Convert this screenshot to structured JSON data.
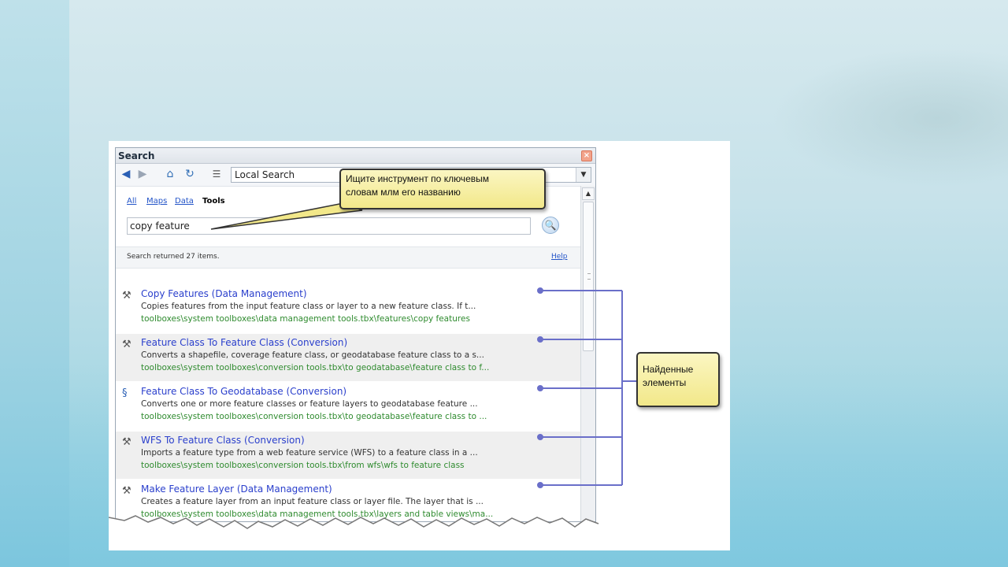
{
  "window": {
    "title": "Search",
    "close_glyph": "×"
  },
  "toolbar": {
    "back_icon": "back-arrow-icon",
    "forward_icon": "forward-arrow-icon",
    "home_icon": "home-icon",
    "refresh_icon": "refresh-icon",
    "index_icon": "index-icon",
    "scope_value": "Local Search"
  },
  "tabs": [
    {
      "label": "All"
    },
    {
      "label": "Maps"
    },
    {
      "label": "Data"
    },
    {
      "label": "Tools"
    }
  ],
  "search": {
    "query": "copy feature",
    "status": "Search returned 27 items.",
    "help_label": "Help"
  },
  "results": [
    {
      "title": "Copy Features (Data Management)",
      "description": "Copies features from the input feature class or layer to a new feature class. If t...",
      "path": "toolboxes\\system toolboxes\\data management tools.tbx\\features\\copy features",
      "icon": "hammer-icon"
    },
    {
      "title": "Feature Class To Feature Class (Conversion)",
      "description": "Converts a shapefile, coverage feature class, or geodatabase feature class to a s...",
      "path": "toolboxes\\system toolboxes\\conversion tools.tbx\\to geodatabase\\feature class to f...",
      "icon": "hammer-icon"
    },
    {
      "title": "Feature Class To Geodatabase (Conversion)",
      "description": "Converts one or more feature classes or feature layers to geodatabase feature ...",
      "path": "toolboxes\\system toolboxes\\conversion tools.tbx\\to geodatabase\\feature class to ...",
      "icon": "script-icon"
    },
    {
      "title": "WFS To Feature Class (Conversion)",
      "description": "Imports a feature type from a web feature service (WFS) to a feature class in a ...",
      "path": "toolboxes\\system toolboxes\\conversion tools.tbx\\from wfs\\wfs to feature class",
      "icon": "hammer-icon"
    },
    {
      "title": "Make Feature Layer (Data Management)",
      "description": "Creates a feature layer from an input feature class or layer file. The layer that is ...",
      "path": "toolboxes\\system toolboxes\\data management tools.tbx\\layers and table views\\ma...",
      "icon": "hammer-icon"
    }
  ],
  "callouts": {
    "search_hint_line1": "Ищите инструмент по ключевым",
    "search_hint_line2": "словам млм его названию",
    "found_line1": "Найденные",
    "found_line2": "элементы"
  },
  "colors": {
    "title_link": "#2a3fcc",
    "path_green": "#2f8b2f",
    "bracket_line": "#6a6fc9",
    "callout_fill": "#f5ec9a"
  }
}
